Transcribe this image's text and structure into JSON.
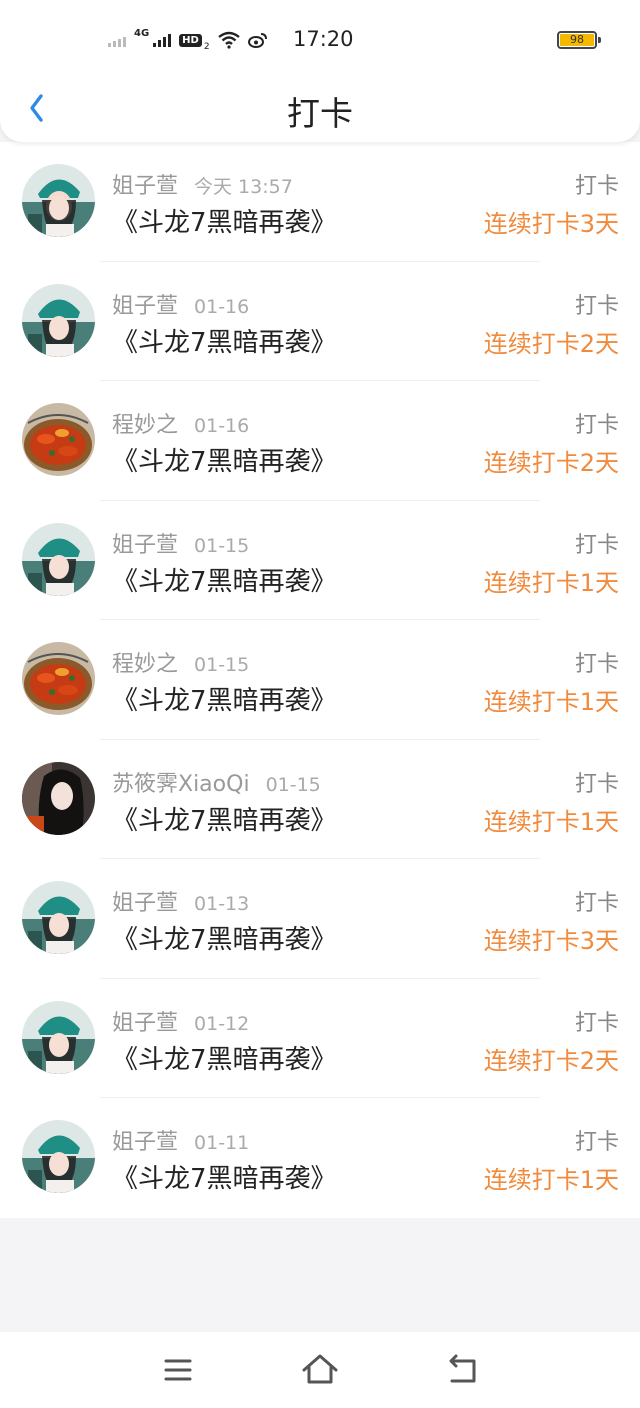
{
  "status": {
    "network": "4G",
    "hd": "HD",
    "hd_sub": "2",
    "time": "17:20",
    "battery": "98"
  },
  "header": {
    "title": "打卡"
  },
  "items": [
    {
      "name": "姐子萱",
      "date": "今天 13:57",
      "book": "《斗龙7黑暗再袭》",
      "type": "打卡",
      "streak": "连续打卡3天",
      "avatar": "girl-teal-hat"
    },
    {
      "name": "姐子萱",
      "date": "01-16",
      "book": "《斗龙7黑暗再袭》",
      "type": "打卡",
      "streak": "连续打卡2天",
      "avatar": "girl-teal-hat"
    },
    {
      "name": "程妙之",
      "date": "01-16",
      "book": "《斗龙7黑暗再袭》",
      "type": "打卡",
      "streak": "连续打卡2天",
      "avatar": "crayfish-dish"
    },
    {
      "name": "姐子萱",
      "date": "01-15",
      "book": "《斗龙7黑暗再袭》",
      "type": "打卡",
      "streak": "连续打卡1天",
      "avatar": "girl-teal-hat"
    },
    {
      "name": "程妙之",
      "date": "01-15",
      "book": "《斗龙7黑暗再袭》",
      "type": "打卡",
      "streak": "连续打卡1天",
      "avatar": "crayfish-dish"
    },
    {
      "name": "苏筱霁XiaoQi",
      "date": "01-15",
      "book": "《斗龙7黑暗再袭》",
      "type": "打卡",
      "streak": "连续打卡1天",
      "avatar": "girl-dark-hair"
    },
    {
      "name": "姐子萱",
      "date": "01-13",
      "book": "《斗龙7黑暗再袭》",
      "type": "打卡",
      "streak": "连续打卡3天",
      "avatar": "girl-teal-hat"
    },
    {
      "name": "姐子萱",
      "date": "01-12",
      "book": "《斗龙7黑暗再袭》",
      "type": "打卡",
      "streak": "连续打卡2天",
      "avatar": "girl-teal-hat"
    },
    {
      "name": "姐子萱",
      "date": "01-11",
      "book": "《斗龙7黑暗再袭》",
      "type": "打卡",
      "streak": "连续打卡1天",
      "avatar": "girl-teal-hat"
    }
  ],
  "colors": {
    "accent": "#f08a3c",
    "back_arrow": "#2d8de6",
    "battery_fill": "#f5b800"
  },
  "navbar": {
    "buttons": [
      "menu-icon",
      "home-icon",
      "back-nav-icon"
    ]
  }
}
